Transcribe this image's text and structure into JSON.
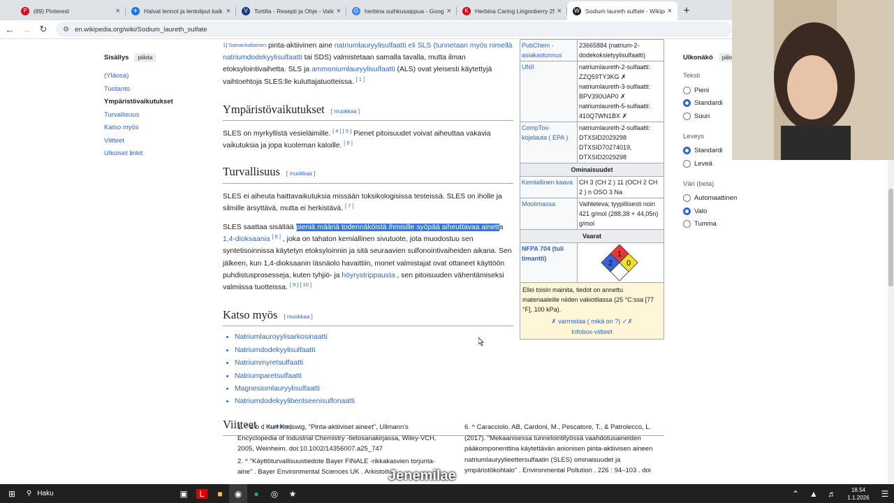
{
  "tabs": [
    {
      "title": "(89) Pinterest",
      "icon": "P",
      "color": "#e60023"
    },
    {
      "title": "Halvat lennot ja lentoliput kaik",
      "icon": "✈",
      "color": "#1a73e8"
    },
    {
      "title": "Tortilla - Resepti ja Ohje - Valio",
      "icon": "V",
      "color": "#1b3a7a"
    },
    {
      "title": "herbina suihkusaippua - Googl",
      "icon": "G",
      "color": "#4285f4"
    },
    {
      "title": "Herbina Caring Lingonberry 25",
      "icon": "K",
      "color": "#e30613"
    },
    {
      "title": "Sodium laureth sulfate - Wikipe",
      "icon": "W",
      "color": "#222"
    }
  ],
  "url": "en.wikipedia.org/wiki/Sodium_laureth_sulfate",
  "toc": {
    "title": "Sisällys",
    "hide": "piilota",
    "items": [
      "(Yläosa)",
      "Tuotanto",
      "Ympäristövaikutukset",
      "Turvallisuus",
      "Katso myös",
      "Viitteet",
      "Ulkoiset linkit"
    ]
  },
  "article": {
    "p1a": "1] Samankaltainen",
    "p1b": " pinta-aktiivinen aine ",
    "p1link": "natriumlauryylisulfaatti eli SLS (tunnetaan myös nimellä natriumdodekyylisulfaatti",
    "p1c": " tai SDS) valmistetaan samalla tavalla, mutta ilman etoksylointivaihetta. SLS ja ",
    "p1link2": "ammoniumlauryylisulfaatti",
    "p1d": " (ALS) ovat yleisesti käytettyjä vaihtoehtoja SLES:lle kuluttajatuotteissa.",
    "p1ref": "[ 1 ]",
    "edit": "muokkaa",
    "h_env": "Ympäristövaikutukset",
    "env_a": "SLES on myrkyllistä vesieläimille.",
    "env_ref": "[ 4 ] [ 5 ]",
    "env_b": " Pienet pitoisuudet voivat aiheuttaa vakavia vaikutuksia ja jopa kuoleman kaloille.",
    "env_ref2": "[ 6 ]",
    "h_safe": "Turvallisuus",
    "safe1": "SLES ei aiheuta haittavaikutuksia missään toksikologisissa testeissä. SLES on iholle ja silmille ärsyttävä, mutta ei herkistävä.",
    "safe1ref": "[ 7 ]",
    "safe2a": "SLES saattaa sisältää ",
    "safe2hl": "pieniä määriä todennäköistä ihmisille syöpää aiheuttavaa ainett",
    "safe2b": "a",
    "safe2link": "1,4-dioksaania",
    "safe2ref": "[ 8 ]",
    "safe2c": " , joka on tahaton kemiallinen sivutuote, jota muodostuu sen syntetisoinnissa käytetyn etoksyloinnin ja sitä seuraavien sulfonointivaiheiden aikana. Sen jälkeen, kun 1,4-dioksaanin läsnäolo havaittiin, monet valmistajat ovat ottaneet käyttöön puhdistusprosesseja, kuten tyhjiö- ja ",
    "safe2link2": "höyrystrippausta",
    "safe2d": " , sen pitoisuuden vähentämiseksi valmiissa tuotteissa.",
    "safe2ref2": "[ 9 ] [ 10 ]",
    "h_see": "Katso myös",
    "see": [
      "Natriumlauroyylisarkosinaatti",
      "Natriumdodekyylisulfaatti",
      "Natriummyretsulfaatti",
      "Natriumparetsulfaatti",
      "Magnesiumlauryylisulfaatti",
      "Natriumdodekyylibentseenisulfonaatti"
    ],
    "h_refs": "Viitteet"
  },
  "infobox": {
    "rows": [
      {
        "k": "PubChem - asiakastunnus",
        "v": "23665884 (natrium-2-dodekoksietyylisulfaatti)"
      },
      {
        "k": "UNII",
        "v": "natriumlaureth-2-sulfaatti: ZZQ59TY3KG ✗ natriumlaureth-3-sulfaatti: BPV390UAP0 ✗ natriumlaureth-5-sulfaatti: 410Q7WN1BX ✗"
      },
      {
        "k": "CompTox-kojelauta ( EPA )",
        "v": "natriumlaureth-2-sulfaatti: DTXSID2029298 DTXSID70274019, DTXSID2029298"
      }
    ],
    "props_head": "Ominaisuudet",
    "formula_k": "Kemiallinen kaava",
    "formula_v": "CH 3 (CH 2 ) 11 (OCH 2 CH 2 ) n OSO 3 Na",
    "molar_k": "Moolimassa",
    "molar_v": "Vaihteleva; tyypillisesti noin 421 g/mol (288,38 + 44,05n) g/mol",
    "hazard_head": "Vaarat",
    "nfpa_k": "NFPA 704 (tuli timantti)",
    "nfpa": [
      "1",
      "2",
      "0"
    ],
    "foot": "Ellei toisin mainita, tiedot on annettu materiaaleille niiden vakiotilassa (25 °C:ssa [77 °F], 100 kPa).",
    "verify": "✗ varmistaa ( mikä on ?) ✓✗",
    "refs": "Infobox-viitteet"
  },
  "appearance": {
    "title": "Ulkonäkö",
    "hide": "piilo",
    "text_label": "Teksti",
    "text_opts": [
      "Pieni",
      "Standardi",
      "Suuri"
    ],
    "text_sel": 1,
    "width_label": "Leveys",
    "width_opts": [
      "Standardi",
      "Leveä"
    ],
    "width_sel": 0,
    "color_label": "Väri (beta)",
    "color_opts": [
      "Automaattinen",
      "Valo",
      "Tumma"
    ],
    "color_sel": 1
  },
  "references": {
    "r1": "1. ^ a b c Kurt Kosswig, \"Pinta-aktiiviset aineet\", Ullmann's Encyclopedia of Industrial Chemistry -tietosanakirjassa, Wiley-VCH, 2005, Weinheim. doi:10.1002/14356007.a25_747",
    "r2": "2. ^ \"Käyttöturvallisuustiedote Bayer FINALE -rikkakasvien torjunta-aine\" . Bayer Environmental Sciences UK . Arkistoitu",
    "r6": "6. ^ Caracciolo, AB, Cardoni, M., Pescatore, T., & Patrolecco, L. (2017). \"Mekaanisessa tunnelointityössä vaahdotusaineiden pääkomponenttina käytettävän anionisen pinta-aktiivisen aineen natriumlauryylieettersulfaatin (SLES) ominaisuudet ja ympäristökohtalo\" . Environmental Pollution . 226 : 94–103 . doi"
  },
  "taskbar": {
    "search": "Haku",
    "time": "18.54",
    "date": "1.1.2026"
  },
  "overlay": "Jenemilae"
}
